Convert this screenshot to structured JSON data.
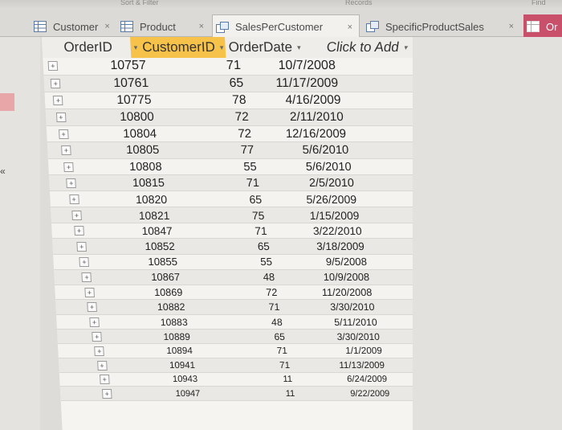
{
  "ribbon": {
    "left_text": "Sort & Filter",
    "mid_text": "Records",
    "right_text": "Find"
  },
  "tabs": [
    {
      "label": "Customer",
      "close": "×",
      "icon": "table-icon"
    },
    {
      "label": "Product",
      "close": "×",
      "icon": "table-icon"
    },
    {
      "label": "SalesPerCustomer",
      "close": "×",
      "icon": "query-icon"
    },
    {
      "label": "SpecificProductSales",
      "close": "×",
      "icon": "query-icon"
    },
    {
      "label": "Or",
      "icon": "table-icon"
    }
  ],
  "columns": {
    "order_id": "OrderID",
    "customer_id": "CustomerID",
    "order_date": "OrderDate",
    "click_to_add": "Click to Add",
    "dropdown_arrow": "▾"
  },
  "nav_arrows": "«",
  "rows": [
    {
      "order_id": "10757",
      "customer_id": "71",
      "order_date": "10/7/2008"
    },
    {
      "order_id": "10761",
      "customer_id": "65",
      "order_date": "11/17/2009"
    },
    {
      "order_id": "10775",
      "customer_id": "78",
      "order_date": "4/16/2009"
    },
    {
      "order_id": "10800",
      "customer_id": "72",
      "order_date": "2/11/2010"
    },
    {
      "order_id": "10804",
      "customer_id": "72",
      "order_date": "12/16/2009"
    },
    {
      "order_id": "10805",
      "customer_id": "77",
      "order_date": "5/6/2010"
    },
    {
      "order_id": "10808",
      "customer_id": "55",
      "order_date": "5/6/2010"
    },
    {
      "order_id": "10815",
      "customer_id": "71",
      "order_date": "2/5/2010"
    },
    {
      "order_id": "10820",
      "customer_id": "65",
      "order_date": "5/26/2009"
    },
    {
      "order_id": "10821",
      "customer_id": "75",
      "order_date": "1/15/2009"
    },
    {
      "order_id": "10847",
      "customer_id": "71",
      "order_date": "3/22/2010"
    },
    {
      "order_id": "10852",
      "customer_id": "65",
      "order_date": "3/18/2009"
    },
    {
      "order_id": "10855",
      "customer_id": "55",
      "order_date": "9/5/2008"
    },
    {
      "order_id": "10867",
      "customer_id": "48",
      "order_date": "10/9/2008"
    },
    {
      "order_id": "10869",
      "customer_id": "72",
      "order_date": "11/20/2008"
    },
    {
      "order_id": "10882",
      "customer_id": "71",
      "order_date": "3/30/2010"
    },
    {
      "order_id": "10883",
      "customer_id": "48",
      "order_date": "5/11/2010"
    },
    {
      "order_id": "10889",
      "customer_id": "65",
      "order_date": "3/30/2010"
    },
    {
      "order_id": "10894",
      "customer_id": "71",
      "order_date": "1/1/2009"
    },
    {
      "order_id": "10941",
      "customer_id": "71",
      "order_date": "11/13/2009"
    },
    {
      "order_id": "10943",
      "customer_id": "11",
      "order_date": "6/24/2009"
    },
    {
      "order_id": "10947",
      "customer_id": "11",
      "order_date": "9/22/2009"
    }
  ],
  "colors": {
    "selected_header": "#f6c24a",
    "accent_tab": "#c8506a"
  }
}
